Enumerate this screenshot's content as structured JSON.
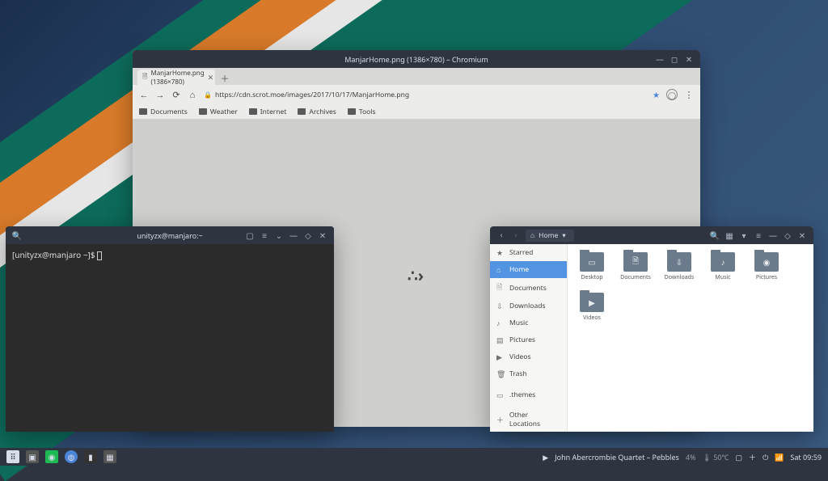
{
  "browser": {
    "window_title": "ManjarHome.png (1386×780) – Chromium",
    "tab_label": "ManjarHome.png (1386×780)",
    "url": "https://cdn.scrot.moe/images/2017/10/17/ManjarHome.png",
    "bookmarks": [
      "Documents",
      "Weather",
      "Internet",
      "Archives",
      "Tools"
    ]
  },
  "terminal": {
    "title": "unityzx@manjaro:~",
    "prompt": "[unityzx@manjaro ~]$ "
  },
  "files": {
    "breadcrumb": "Home",
    "sidebar": [
      {
        "icon": "★",
        "label": "Starred"
      },
      {
        "icon": "⌂",
        "label": "Home"
      },
      {
        "icon": "🗎",
        "label": "Documents"
      },
      {
        "icon": "⇩",
        "label": "Downloads"
      },
      {
        "icon": "♪",
        "label": "Music"
      },
      {
        "icon": "▤",
        "label": "Pictures"
      },
      {
        "icon": "▶",
        "label": "Videos"
      },
      {
        "icon": "🗑",
        "label": "Trash"
      },
      {
        "icon": "▭",
        "label": ".themes"
      },
      {
        "icon": "＋",
        "label": "Other Locations"
      }
    ],
    "items": [
      {
        "name": "Desktop",
        "sym": "▭"
      },
      {
        "name": "Documents",
        "sym": "🗎"
      },
      {
        "name": "Downloads",
        "sym": "⇩"
      },
      {
        "name": "Music",
        "sym": "♪"
      },
      {
        "name": "Pictures",
        "sym": "◉"
      },
      {
        "name": "Videos",
        "sym": "▶"
      }
    ]
  },
  "panel": {
    "media_text": "John Abercrombie Quartet – Pebbles",
    "battery": "4%",
    "temp": "50℃",
    "clock": "Sat 09:59"
  }
}
